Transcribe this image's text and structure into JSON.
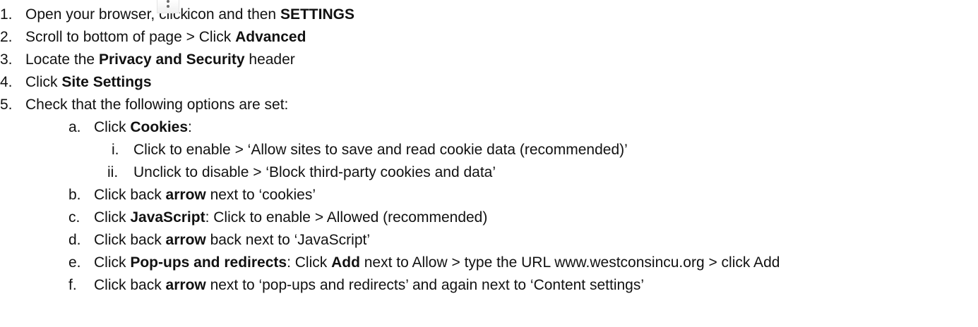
{
  "steps": [
    {
      "marker": "1.",
      "pre": "Open your browser, click",
      "icon": "more-vert-icon",
      "mid": "icon and then",
      "bold": "SETTINGS"
    },
    {
      "marker": "2.",
      "pre": "Scroll to bottom of page > Click",
      "bold": "Advanced"
    },
    {
      "marker": "3.",
      "pre": "Locate the",
      "bold": "Privacy and Security",
      "post": "header"
    },
    {
      "marker": "4.",
      "pre": "Click",
      "bold": "Site Settings"
    },
    {
      "marker": "5.",
      "pre": "Check that the following options are set:"
    }
  ],
  "substeps": [
    {
      "marker": "a.",
      "pre": "Click",
      "bold": "Cookies",
      "post": ":"
    },
    {
      "marker": "i.",
      "text": "Click to enable > ‘Allow sites to save and read cookie data (recommended)’"
    },
    {
      "marker": "ii.",
      "text": "Unclick to disable > ‘Block third-party cookies and data’"
    },
    {
      "marker": "b.",
      "pre": "Click back",
      "bold": "arrow",
      "post": "next to ‘cookies’"
    },
    {
      "marker": "c.",
      "pre": "Click",
      "bold": "JavaScript",
      "post": ": Click to enable > Allowed (recommended)"
    },
    {
      "marker": "d.",
      "pre": "Click back",
      "bold": "arrow",
      "post": "back next to ‘JavaScript’"
    },
    {
      "marker": "e.",
      "pre": "Click",
      "bold": "Pop-ups and redirects",
      "mid": ": Click",
      "bold2": "Add",
      "post": "next to Allow > type the URL www.westconsincu.org > click Add"
    },
    {
      "marker": "f.",
      "pre": "Click back",
      "bold": "arrow",
      "post": "next to ‘pop-ups and redirects’ and again next to ‘Content settings’"
    }
  ]
}
